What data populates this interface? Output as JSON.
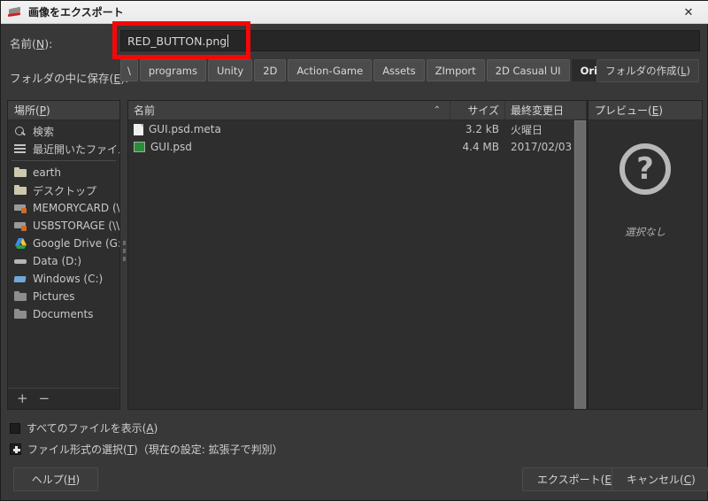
{
  "window": {
    "title": "画像をエクスポート",
    "icon": "gimp-export-icon",
    "close_label": "✕"
  },
  "name_row": {
    "label": "名前(N):",
    "label_text": "名前(",
    "label_mnemonic": "N",
    "label_tail": "):",
    "value": "RED_BUTTON.png",
    "placeholder": ""
  },
  "path_row": {
    "label_text": "フォルダの中に保存(",
    "label_mnemonic": "E",
    "label_tail": "):",
    "crumbs": [
      {
        "label": "\\",
        "active": false
      },
      {
        "label": "programs",
        "active": false
      },
      {
        "label": "Unity",
        "active": false
      },
      {
        "label": "2D",
        "active": false
      },
      {
        "label": "Action-Game",
        "active": false
      },
      {
        "label": "Assets",
        "active": false
      },
      {
        "label": "ZImport",
        "active": false
      },
      {
        "label": "2D Casual UI",
        "active": false
      },
      {
        "label": "Original Artwork",
        "active": true
      }
    ],
    "new_folder_text": "フォルダの作成(",
    "new_folder_mnemonic": "L",
    "new_folder_tail": ")"
  },
  "places": {
    "header_text": "場所(",
    "header_mnemonic": "P",
    "header_tail": ")",
    "items": [
      {
        "label": "検索",
        "icon": "search-icon"
      },
      {
        "label": "最近開いたファイル",
        "icon": "recent-files-icon"
      },
      {
        "label": "earth",
        "icon": "folder-icon"
      },
      {
        "label": "デスクトップ",
        "icon": "folder-icon"
      },
      {
        "label": "MEMORYCARD (\\\\E...",
        "icon": "network-drive-icon"
      },
      {
        "label": "USBSTORAGE (\\\\E...",
        "icon": "network-drive-icon"
      },
      {
        "label": "Google Drive (G:)",
        "icon": "google-drive-icon"
      },
      {
        "label": "Data (D:)",
        "icon": "drive-icon"
      },
      {
        "label": "Windows (C:)",
        "icon": "windows-drive-icon"
      },
      {
        "label": "Pictures",
        "icon": "folder-gray-icon"
      },
      {
        "label": "Documents",
        "icon": "folder-gray-icon"
      }
    ],
    "add_label": "+",
    "remove_label": "−"
  },
  "filelist": {
    "columns": {
      "name": "名前",
      "size": "サイズ",
      "modified": "最終変更日",
      "sort_indicator": "⌃"
    },
    "rows": [
      {
        "name": "GUI.psd",
        "icon": "psd-file-icon",
        "size": "4.4 MB",
        "modified": "2017/02/03"
      },
      {
        "name": "GUI.psd.meta",
        "icon": "text-file-icon",
        "size": "3.2 kB",
        "modified": "火曜日"
      }
    ]
  },
  "preview": {
    "header_text": "プレビュー(",
    "header_mnemonic": "E",
    "header_tail": ")",
    "icon": "question-mark-icon",
    "icon_glyph": "?",
    "empty_text": "選択なし"
  },
  "options": {
    "show_all_files": {
      "text": "すべてのファイルを表示(",
      "mnemonic": "A",
      "tail": ")",
      "checked": false
    },
    "file_type": {
      "text": "ファイル形式の選択(",
      "mnemonic": "T",
      "tail": ")（現在の設定: 拡張子で判別）",
      "expanded": false
    }
  },
  "buttons": {
    "help": {
      "text": "ヘルプ(",
      "mnemonic": "H",
      "tail": ")"
    },
    "export": {
      "text": "エクスポート(",
      "mnemonic": "E",
      "tail": ")"
    },
    "cancel": {
      "text": "キャンセル(",
      "mnemonic": "C",
      "tail": ")"
    }
  },
  "annotation": {
    "highlight_color": "#f60707",
    "target": "name-field"
  }
}
